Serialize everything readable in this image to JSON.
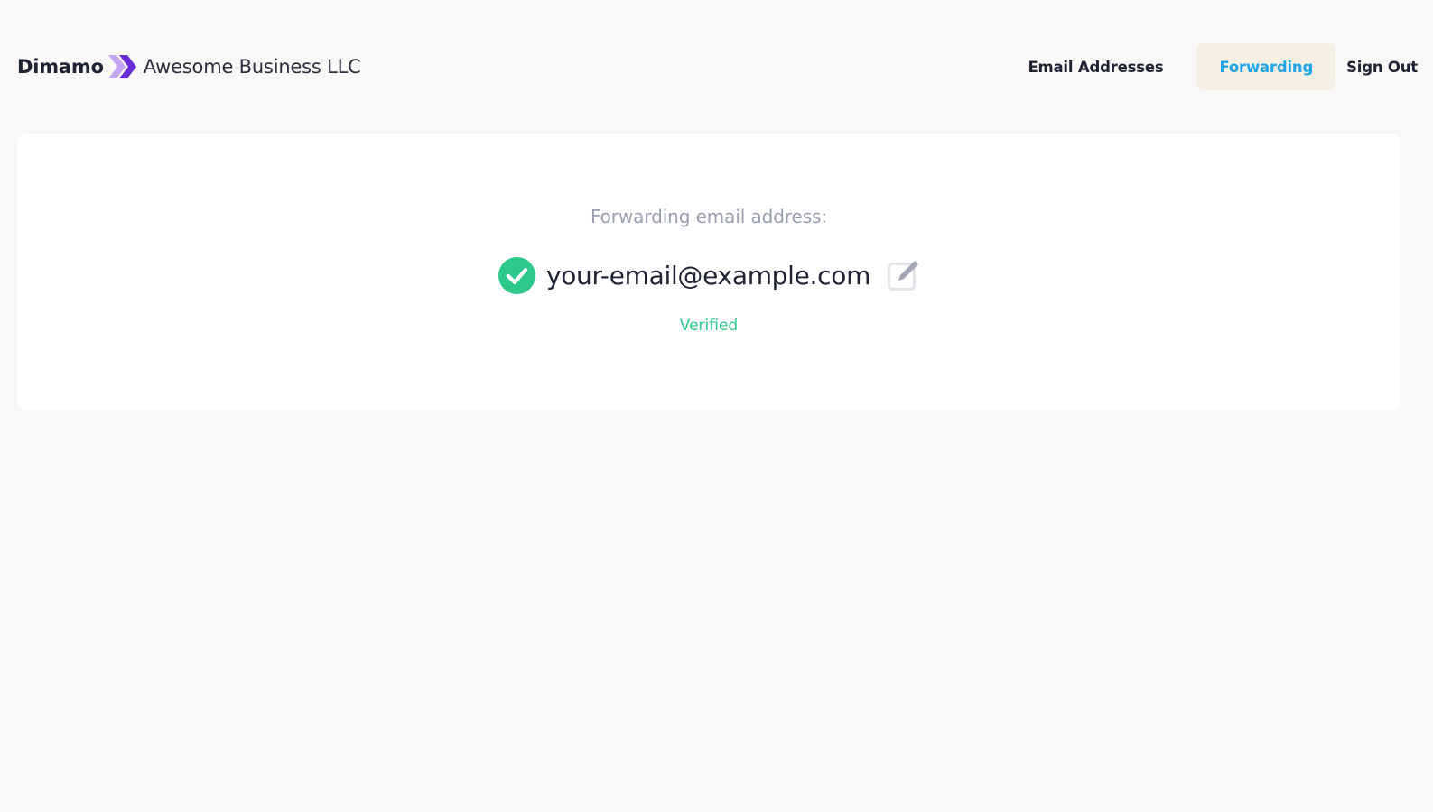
{
  "header": {
    "brand": "Dimamo",
    "brand_logo_icon": "double-chevron-right-icon",
    "company": "Awesome Business LLC"
  },
  "nav": {
    "items": [
      {
        "label": "Email Addresses"
      },
      {
        "label": "Forwarding",
        "active": true
      },
      {
        "label": "Sign Out"
      }
    ]
  },
  "forwarding": {
    "label": "Forwarding email address:",
    "email": "your-email@example.com",
    "status": "Verified",
    "status_icon": "check-circle-icon",
    "edit_icon": "edit-icon"
  },
  "colors": {
    "background": "#f9f8f6",
    "card": "#ffffff",
    "accent": "#1ea4e9",
    "active_tab_bg": "#f6efe4",
    "success": "#2cc98a",
    "logo_purple_light": "#b38ef0",
    "logo_purple_dark": "#6a2cd8",
    "muted_text": "#9a9fb0"
  }
}
